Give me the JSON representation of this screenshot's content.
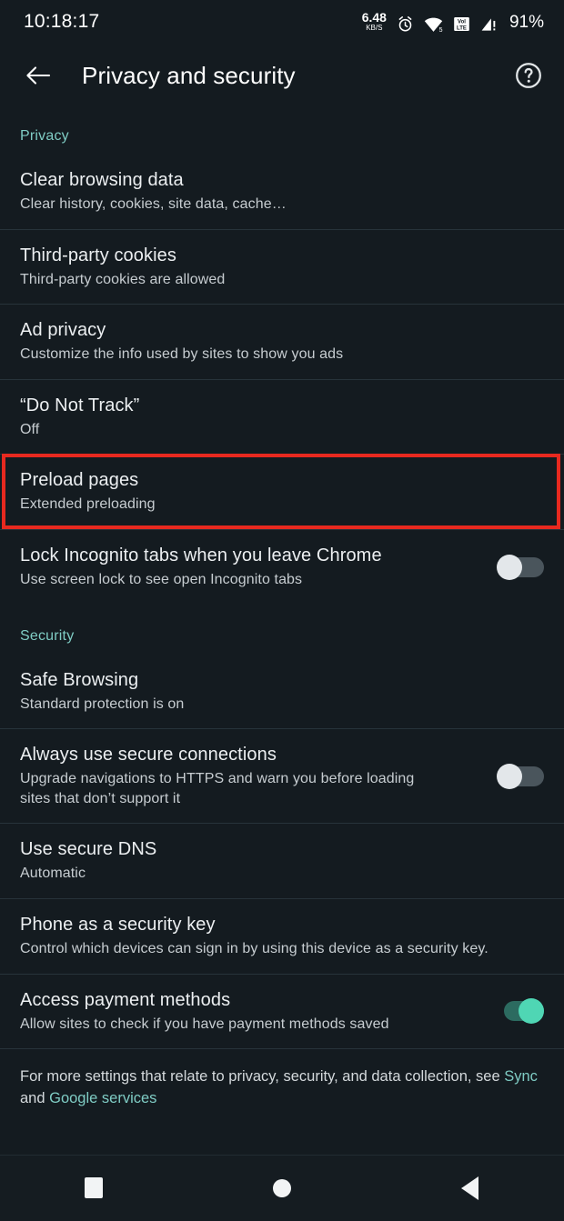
{
  "status_bar": {
    "clock": "10:18:17",
    "net_speed_value": "6.48",
    "net_speed_unit": "KB/S",
    "alarm_icon": "alarm-icon",
    "wifi_icon": "wifi-icon",
    "volte_icon": "volte-icon",
    "signal_icon": "signal-warning-icon",
    "battery": "91%"
  },
  "app_bar": {
    "back_icon": "back-arrow-icon",
    "title": "Privacy and security",
    "help_icon": "help-circle-icon"
  },
  "sections": [
    {
      "id": "privacy",
      "label": "Privacy"
    },
    {
      "id": "security",
      "label": "Security"
    }
  ],
  "privacy_items": [
    {
      "title": "Clear browsing data",
      "subtitle": "Clear history, cookies, site data, cache…",
      "toggle": null
    },
    {
      "title": "Third-party cookies",
      "subtitle": "Third-party cookies are allowed",
      "toggle": null
    },
    {
      "title": "Ad privacy",
      "subtitle": "Customize the info used by sites to show you ads",
      "toggle": null
    },
    {
      "title": "“Do Not Track”",
      "subtitle": "Off",
      "toggle": null
    },
    {
      "title": "Preload pages",
      "subtitle": "Extended preloading",
      "toggle": null,
      "highlighted": true
    },
    {
      "title": "Lock Incognito tabs when you leave Chrome",
      "subtitle": "Use screen lock to see open Incognito tabs",
      "toggle": "off"
    }
  ],
  "security_items": [
    {
      "title": "Safe Browsing",
      "subtitle": "Standard protection is on",
      "toggle": null
    },
    {
      "title": "Always use secure connections",
      "subtitle": "Upgrade navigations to HTTPS and warn you before loading sites that don’t support it",
      "toggle": "off"
    },
    {
      "title": "Use secure DNS",
      "subtitle": "Automatic",
      "toggle": null
    },
    {
      "title": "Phone as a security key",
      "subtitle": "Control which devices can sign in by using this device as a security key.",
      "toggle": null
    },
    {
      "title": "Access payment methods",
      "subtitle": "Allow sites to check if you have payment methods saved",
      "toggle": "on"
    }
  ],
  "footer": {
    "text_before": "For more settings that relate to privacy, security, and data collection, see ",
    "link_sync": "Sync",
    "text_middle": " and ",
    "link_google_services": "Google services"
  },
  "nav_bar": {
    "recents_icon": "square-recents-icon",
    "home_icon": "circle-home-icon",
    "back_icon": "triangle-back-icon"
  },
  "colors": {
    "background": "#141b20",
    "accent_teal": "#7fccc4",
    "toggle_on": "#4fd6b4",
    "highlight_red": "#e8291f",
    "divider": "#27333a"
  }
}
